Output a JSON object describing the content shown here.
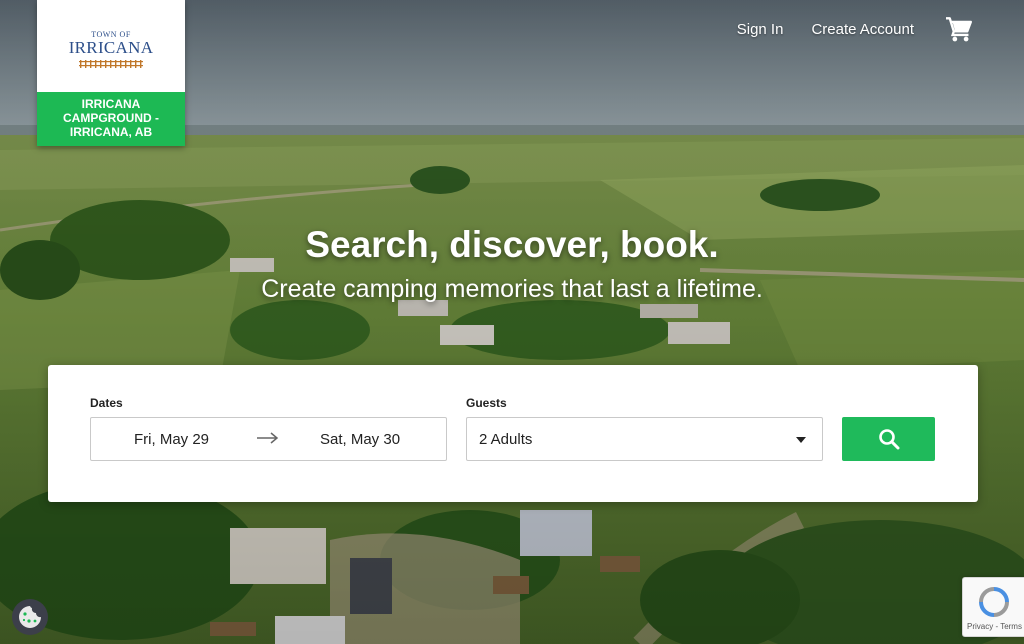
{
  "logo": {
    "small": "TOWN OF",
    "big": "IRRICANA",
    "campground_name": "IRRICANA CAMPGROUND - IRRICANA, AB"
  },
  "nav": {
    "sign_in": "Sign In",
    "create_account": "Create Account",
    "cart_icon": "shopping-cart-icon"
  },
  "hero": {
    "headline": "Search, discover, book.",
    "subline": "Create camping memories that last a lifetime."
  },
  "search": {
    "dates_label": "Dates",
    "date_from": "Fri, May 29",
    "date_to": "Sat, May 30",
    "guests_label": "Guests",
    "guests_value": "2 Adults",
    "button_icon": "search-icon"
  },
  "widgets": {
    "cookie_icon": "cookie-icon",
    "recaptcha_links": "Privacy - Terms"
  },
  "colors": {
    "accent": "#1fba5b",
    "logo_text": "#2d4f8a"
  }
}
